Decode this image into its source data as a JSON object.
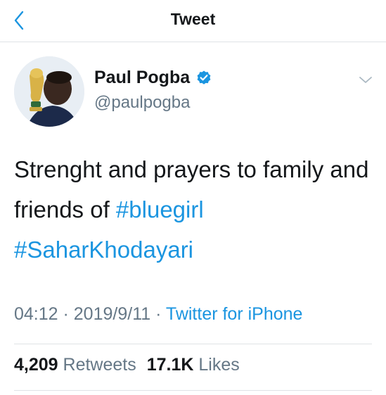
{
  "nav": {
    "title": "Tweet",
    "back_icon": "chevron-left-icon"
  },
  "colors": {
    "accent": "#1b95e0",
    "text": "#14171a",
    "muted": "#657786",
    "divider": "#dfe3e6"
  },
  "author": {
    "display_name": "Paul Pogba",
    "handle": "@paulpogba",
    "verified_icon": "verified-badge-icon",
    "avatar_icon": "avatar"
  },
  "tweet": {
    "text_plain": "Strenght and prayers to family and friends of ",
    "hashtag1": "#bluegirl",
    "hashtag2": "#SaharKhodayari"
  },
  "meta": {
    "time": "04:12",
    "sep1": " · ",
    "date": "2019/9/11",
    "sep2": " · ",
    "source": "Twitter for iPhone"
  },
  "stats": {
    "retweets_count": "4,209",
    "retweets_label": "Retweets",
    "likes_count": "17.1K",
    "likes_label": "Likes"
  }
}
